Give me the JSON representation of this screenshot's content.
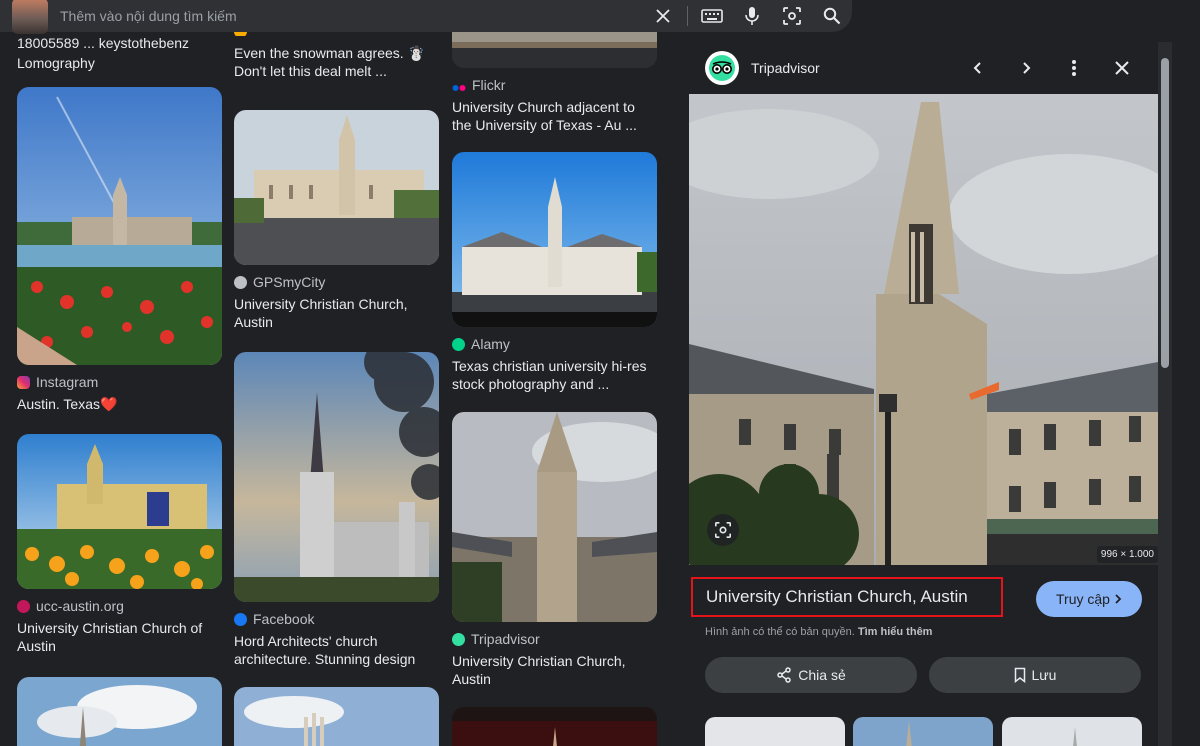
{
  "search": {
    "placeholder": "Thêm vào nội dung tìm kiếm"
  },
  "col1": {
    "top_partial_text": "18005589 ... keystothebenz",
    "top_caption": "Lomography",
    "cards": [
      {
        "source": "Instagram",
        "source_color": "#e1306c",
        "caption": "Austin. Texas❤️"
      },
      {
        "source": "ucc-austin.org",
        "source_color": "#c2185b",
        "caption": "University Christian Church of Austin"
      }
    ]
  },
  "col2": {
    "top_caption": "Even the snowman agrees. ☃️ Don't let this deal melt ...",
    "cards": [
      {
        "source": "GPSmyCity",
        "source_color": "#bdc1c6",
        "caption": "University Christian Church, Austin"
      },
      {
        "source": "Facebook",
        "source_color": "#1877f2",
        "caption": "Hord Architects' church architecture. Stunning design"
      }
    ]
  },
  "col3": {
    "cards": [
      {
        "source": "Flickr",
        "source_color": "#ff0084",
        "caption": "University Church adjacent to the University of Texas - Au ..."
      },
      {
        "source": "Alamy",
        "source_color": "#00d18b",
        "caption": "Texas christian university hi-res stock photography and ..."
      },
      {
        "source": "Tripadvisor",
        "source_color": "#34e0a1",
        "caption": "University Christian Church, Austin"
      }
    ]
  },
  "panel": {
    "source_name": "Tripadvisor",
    "dimensions": "996 × 1.000",
    "title": "University Christian Church, Austin",
    "visit_label": "Truy cập",
    "copyright_text": "Hình ảnh có thể có bản quyền.",
    "learn_more": "Tìm hiểu thêm",
    "share_label": "Chia sẻ",
    "save_label": "Lưu"
  },
  "icons": {
    "clear": "close-icon",
    "keyboard": "keyboard-icon",
    "mic": "mic-icon",
    "lens": "lens-icon",
    "search": "search-icon"
  }
}
